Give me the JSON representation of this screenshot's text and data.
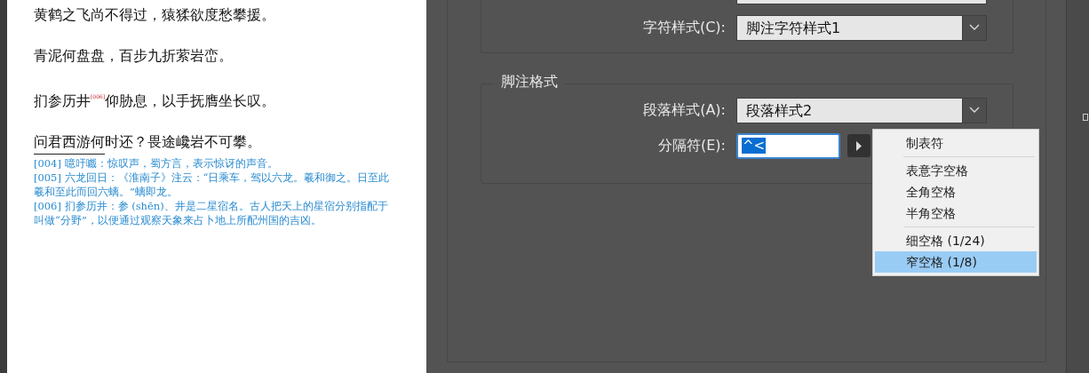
{
  "document": {
    "poem_lines": [
      "黄鹤之飞尚不得过，猿猱欲度愁攀援。",
      "青泥何盘盘，百步九折萦岩峦。",
      "扪参历井$^{[006]}$仰胁息，以手抚膺坐长叹。",
      "问君西游何时还？畏途巉岩不可攀。"
    ],
    "footnotes": [
      {
        "lines": [
          "[004] 噫吁嚱：惊叹声，蜀方言，表示惊讶的声音。"
        ]
      },
      {
        "lines": [
          "[005] 六龙回日：《淮南子》注云：“日乘车，驾以六龙。羲和御之。日至此",
          "羲和至此而回六螭。”螭即龙。"
        ]
      },
      {
        "lines": [
          "[006] 扪参历井：参 (shēn)、井是二星宿名。古人把天上的星宿分别指配于",
          "叫做“分野”，以便通过观察天象来占卜地上所配州国的吉凶。"
        ]
      }
    ]
  },
  "dialog": {
    "character_style": {
      "label": "字符样式(C):",
      "value": "脚注字符样式1"
    },
    "footnote_format": {
      "title": "脚注格式",
      "paragraph_style": {
        "label": "段落样式(A):",
        "value": "段落样式2"
      },
      "separator": {
        "label": "分隔符(E):",
        "value": "^<",
        "text_selected": true
      }
    },
    "special_menu": {
      "items": [
        {
          "kind": "item",
          "label": "制表符",
          "selected": false
        },
        {
          "kind": "separator"
        },
        {
          "kind": "item",
          "label": "表意字空格",
          "selected": false
        },
        {
          "kind": "item",
          "label": "全角空格",
          "selected": false
        },
        {
          "kind": "item",
          "label": "半角空格",
          "selected": false
        },
        {
          "kind": "separator"
        },
        {
          "kind": "item",
          "label": "细空格 (1/24)",
          "selected": false
        },
        {
          "kind": "item",
          "label": "窄空格 (1/8)",
          "selected": true
        }
      ]
    }
  }
}
